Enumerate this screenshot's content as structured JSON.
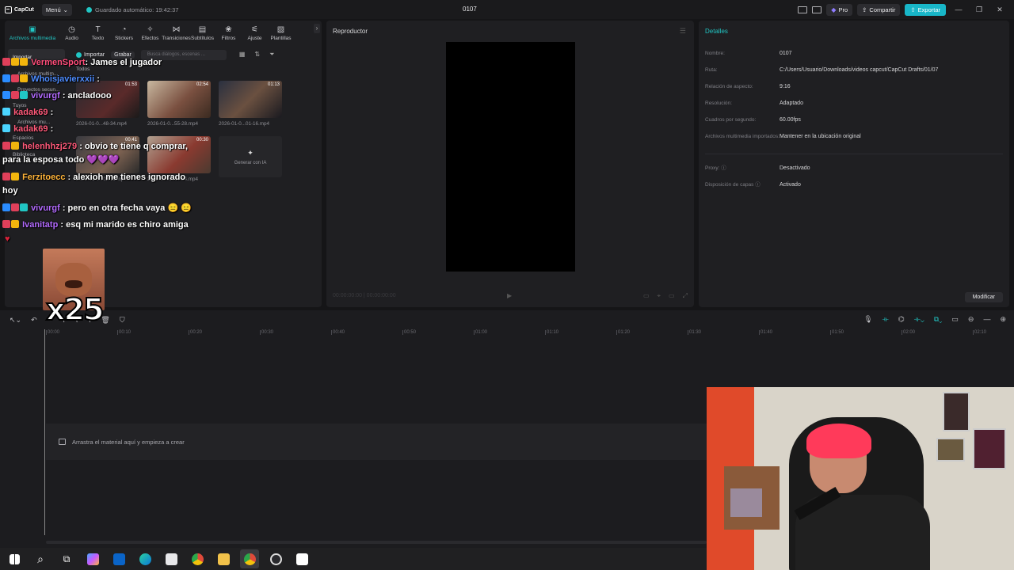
{
  "titlebar": {
    "app_name": "CapCut",
    "menu_label": "Menú",
    "autosave": "Guardado automático: 19:42:37",
    "project_title": "0107",
    "pro_label": "Pro",
    "share_label": "Compartir",
    "export_label": "Exportar"
  },
  "toolbar": {
    "items": [
      {
        "label": "Archivos multimedia",
        "icon": "media-icon"
      },
      {
        "label": "Audio",
        "icon": "audio-icon"
      },
      {
        "label": "Texto",
        "icon": "text-icon"
      },
      {
        "label": "Stickers",
        "icon": "sticker-icon"
      },
      {
        "label": "Efectos",
        "icon": "effects-icon"
      },
      {
        "label": "Transiciones",
        "icon": "transitions-icon"
      },
      {
        "label": "Subtítulos",
        "icon": "subtitles-icon"
      },
      {
        "label": "Filtros",
        "icon": "filters-icon"
      },
      {
        "label": "Ajuste",
        "icon": "adjust-icon"
      },
      {
        "label": "Plantillas",
        "icon": "templates-icon"
      }
    ]
  },
  "sidebar": {
    "items": [
      "Importar",
      "Archivos multim...",
      "Proyectos secun...",
      "Tuyos",
      "Archivos mu...",
      "Espacios",
      "Biblioteca"
    ]
  },
  "media": {
    "import_label": "Importar",
    "record_label": "Grabar",
    "search_placeholder": "Busca diálogos, escenas ...",
    "filter_label": "Todos",
    "generate_ai_label": "Generar con IA",
    "clips": [
      {
        "duration": "01:53",
        "name": "2026-01-0...48-34.mp4"
      },
      {
        "duration": "02:54",
        "name": "2026-01-0...55-28.mp4"
      },
      {
        "duration": "01:13",
        "name": "2026-01-0...01-16.mp4"
      },
      {
        "duration": "00:41",
        "name": "2026-01-0...03-11.mp4"
      },
      {
        "duration": "00:30",
        "name": "2026-01-0...04-14.mp4"
      }
    ]
  },
  "player": {
    "title": "Reproductor",
    "timecode": "00:00:00:00 | 00:00:00:00"
  },
  "details": {
    "title": "Detalles",
    "rows": [
      {
        "key": "Nombre:",
        "value": "0107"
      },
      {
        "key": "Ruta:",
        "value": "C:/Users/Usuario/Downloads/videos capcut/CapCut Drafts/01/07"
      },
      {
        "key": "Relación de aspecto:",
        "value": "9:16"
      },
      {
        "key": "Resolución:",
        "value": "Adaptado"
      },
      {
        "key": "Cuadros por segundo:",
        "value": "60.00fps"
      },
      {
        "key": "Archivos multimedia importados:",
        "value": "Mantener en la ubicación original"
      }
    ],
    "rows2": [
      {
        "key": "Proxy:",
        "value": "Desactivado"
      },
      {
        "key": "Disposición de capas",
        "value": "Activado"
      }
    ],
    "modify_label": "Modificar"
  },
  "timeline": {
    "ticks": [
      "00:00",
      "00:10",
      "00:20",
      "00:30",
      "00:40",
      "00:50",
      "01:00",
      "01:10",
      "01:20",
      "01:30",
      "01:40",
      "01:50",
      "02:00",
      "02:10"
    ],
    "drop_hint": "Arrastra el material aquí y empieza a crear"
  },
  "chat": {
    "messages": [
      {
        "user": "VermenSport",
        "user_color": "#ff4d7a",
        "text": ": James el jugador"
      },
      {
        "user": "Whoisjavierxxii",
        "user_color": "#4d8cff",
        "text": ":"
      },
      {
        "user": "vivurgf",
        "user_color": "#b36bff",
        "text": ": ancladooo"
      },
      {
        "user": "kadak69",
        "user_color": "#ff5a7a",
        "text": ":"
      },
      {
        "user": "kadak69",
        "user_color": "#ff5a7a",
        "text": ":"
      },
      {
        "user": "helenhhzj279",
        "user_color": "#ff5a7a",
        "text": ": obvio te tiene q comprar,"
      },
      {
        "user": "",
        "user_color": "#ffffff",
        "text": "para la esposa todo 💜💜💜"
      },
      {
        "user": "Ferzitoecc",
        "user_color": "#ffb43a",
        "text": ": alexioh me tienes ignorado"
      },
      {
        "user": "",
        "user_color": "#ffffff",
        "text": "hoy"
      },
      {
        "user": "vivurgf",
        "user_color": "#b36bff",
        "text": ": pero en otra fecha vaya 😑 😑"
      },
      {
        "user": "Ivanitatp",
        "user_color": "#b36bff",
        "text": ": esq mi marido es chiro amiga"
      }
    ],
    "meme_text": "x25"
  },
  "taskbar": {
    "apps": [
      "windows-start-icon",
      "search-icon",
      "task-view-icon",
      "copilot-icon",
      "outlook-icon",
      "edge-icon",
      "store-icon",
      "chrome-icon",
      "file-explorer-icon",
      "chrome-profile-icon",
      "obs-icon",
      "capcut-icon"
    ]
  },
  "colors": {
    "accent": "#21c6c4",
    "panel": "#1f1f22",
    "background": "#151517",
    "export": "#18b6c8"
  }
}
